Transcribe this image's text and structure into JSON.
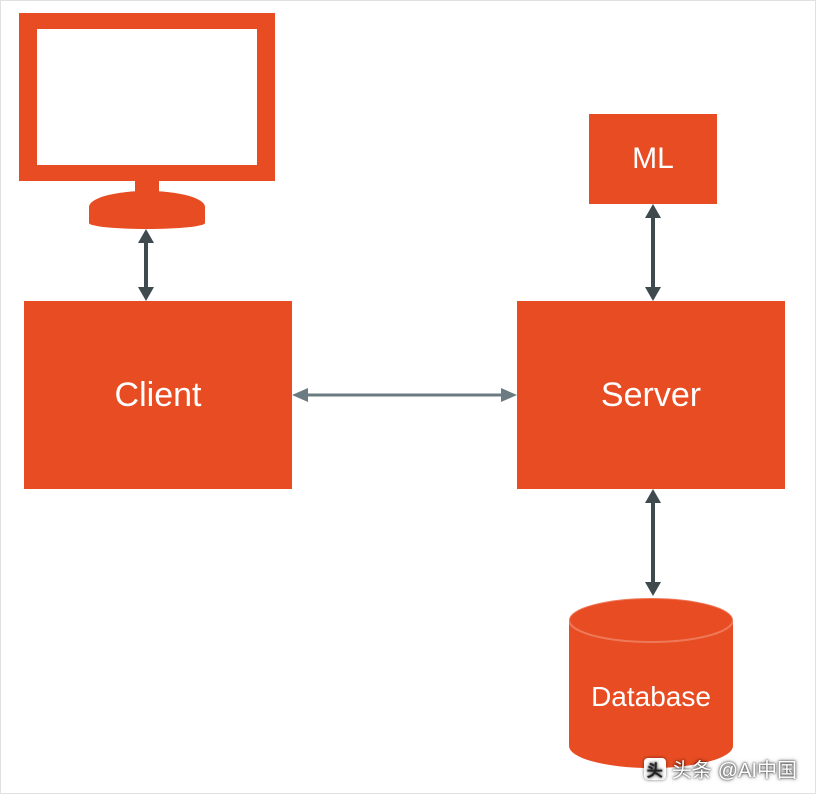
{
  "diagram": {
    "nodes": {
      "client": {
        "label": "Client",
        "type": "box",
        "color": "#e84c22"
      },
      "server": {
        "label": "Server",
        "type": "box",
        "color": "#e84c22"
      },
      "ml": {
        "label": "ML",
        "type": "box",
        "color": "#e84c22"
      },
      "database": {
        "label": "Database",
        "type": "cylinder",
        "color": "#e84c22"
      },
      "monitor": {
        "label": "",
        "type": "monitor-icon",
        "color": "#e84c22"
      }
    },
    "edges": [
      {
        "from": "monitor",
        "to": "client",
        "bidirectional": true
      },
      {
        "from": "client",
        "to": "server",
        "bidirectional": true
      },
      {
        "from": "ml",
        "to": "server",
        "bidirectional": true
      },
      {
        "from": "server",
        "to": "database",
        "bidirectional": true
      }
    ],
    "layout_hint": "Client on left; Server on right; ML above Server; Database below Server; Monitor above Client."
  },
  "watermark": {
    "prefix": "头条",
    "handle": "@AI中国",
    "icon_glyph": "头"
  },
  "palette": {
    "accent": "#e84c22",
    "arrow": "#3f4a4f",
    "arrow_light": "#6b7b82",
    "text_on_accent": "#ffffff"
  }
}
